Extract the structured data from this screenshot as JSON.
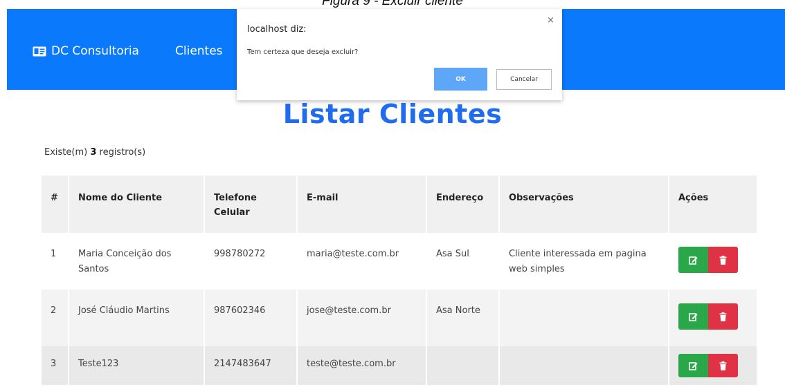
{
  "caption": "Figura 9 - Excluir cliente",
  "navbar": {
    "brand": "DC Consultoria",
    "link": "Clientes",
    "color": "#0a79fb"
  },
  "dialog": {
    "origin": "localhost diz:",
    "close": "×",
    "message": "Tem certeza que deseja excluir?",
    "ok_label": "OK",
    "cancel_label": "Cancelar"
  },
  "page": {
    "title": "Listar Clientes",
    "count_prefix": "Existe(m) ",
    "count_value": "3",
    "count_suffix": " registro(s)"
  },
  "table": {
    "headers": [
      "#",
      "Nome do Cliente",
      "Telefone Celular",
      "E-mail",
      "Endereço",
      "Observações",
      "Ações"
    ],
    "rows": [
      {
        "num": "1",
        "nome": "Maria Conceição dos Santos",
        "telefone": "998780272",
        "email": "maria@teste.com.br",
        "endereco": "Asa Sul",
        "obs": "Cliente interessada em pagina web simples"
      },
      {
        "num": "2",
        "nome": "José Cláudio Martins",
        "telefone": "987602346",
        "email": "jose@teste.com.br",
        "endereco": "Asa Norte",
        "obs": ""
      },
      {
        "num": "3",
        "nome": "Teste123",
        "telefone": "2147483647",
        "email": "teste@teste.com.br",
        "endereco": "",
        "obs": ""
      }
    ]
  },
  "colors": {
    "title": "#1f6cf0",
    "edit": "#2aa748",
    "delete": "#df3345"
  },
  "icons": {
    "brand": "id-card-icon",
    "edit": "edit-icon",
    "delete": "trash-icon"
  }
}
